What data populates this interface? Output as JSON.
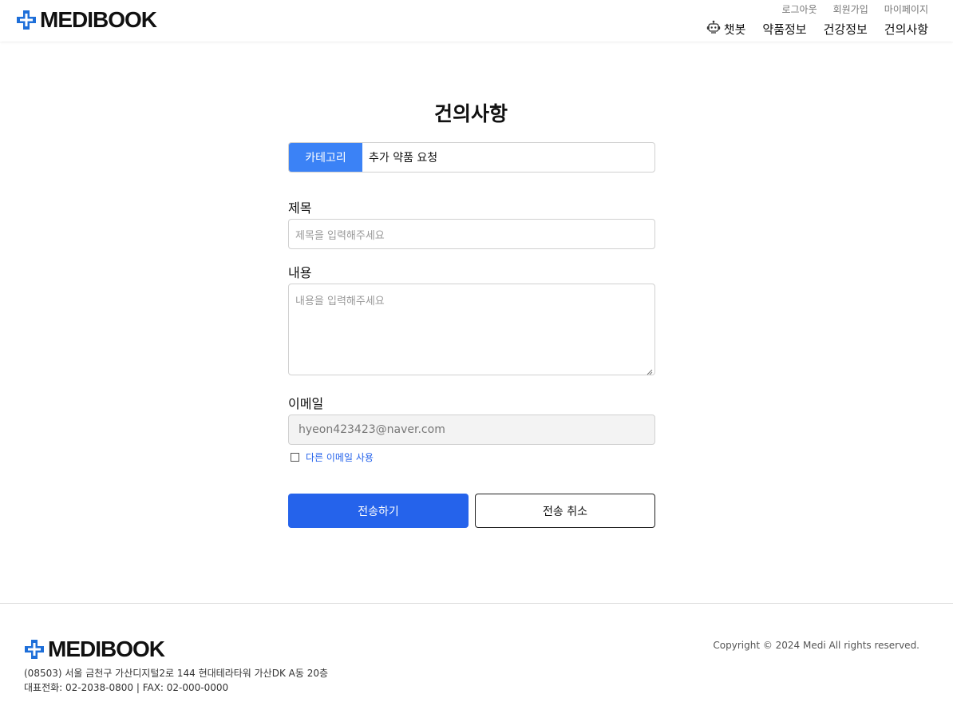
{
  "header": {
    "logo_text": "MEDIBOOK",
    "top_links": [
      "로그아웃",
      "회원가입",
      "마이페이지"
    ],
    "nav": {
      "chatbot": "챗봇",
      "drug_info": "약품정보",
      "health_info": "건강정보",
      "suggestions": "건의사항"
    }
  },
  "form": {
    "title": "건의사항",
    "category_label": "카테고리",
    "category_value": "추가 약품 요청",
    "subject_label": "제목",
    "subject_placeholder": "제목을 입력해주세요",
    "content_label": "내용",
    "content_placeholder": "내용을 입력해주세요",
    "email_label": "이메일",
    "email_value": "hyeon423423@naver.com",
    "other_email_label": "다른 이메일 사용",
    "other_email_checked": false,
    "submit_label": "전송하기",
    "cancel_label": "전송 취소"
  },
  "footer": {
    "logo_text": "MEDIBOOK",
    "address": "(08503) 서울 금천구 가산디지털2로 144 현대테라타워 가산DK A동 20층",
    "contact": "대표전화: 02-2038-0800 | FAX: 02-000-0000",
    "copyright": "Copyright © 2024 Medi All rights reserved."
  },
  "colors": {
    "brand_blue": "#2563eb",
    "category_blue": "#3b82f6",
    "logo_blue": "#1e6fd9"
  },
  "icons": {
    "logo": "medical-cross-icon",
    "chatbot": "robot-icon"
  }
}
